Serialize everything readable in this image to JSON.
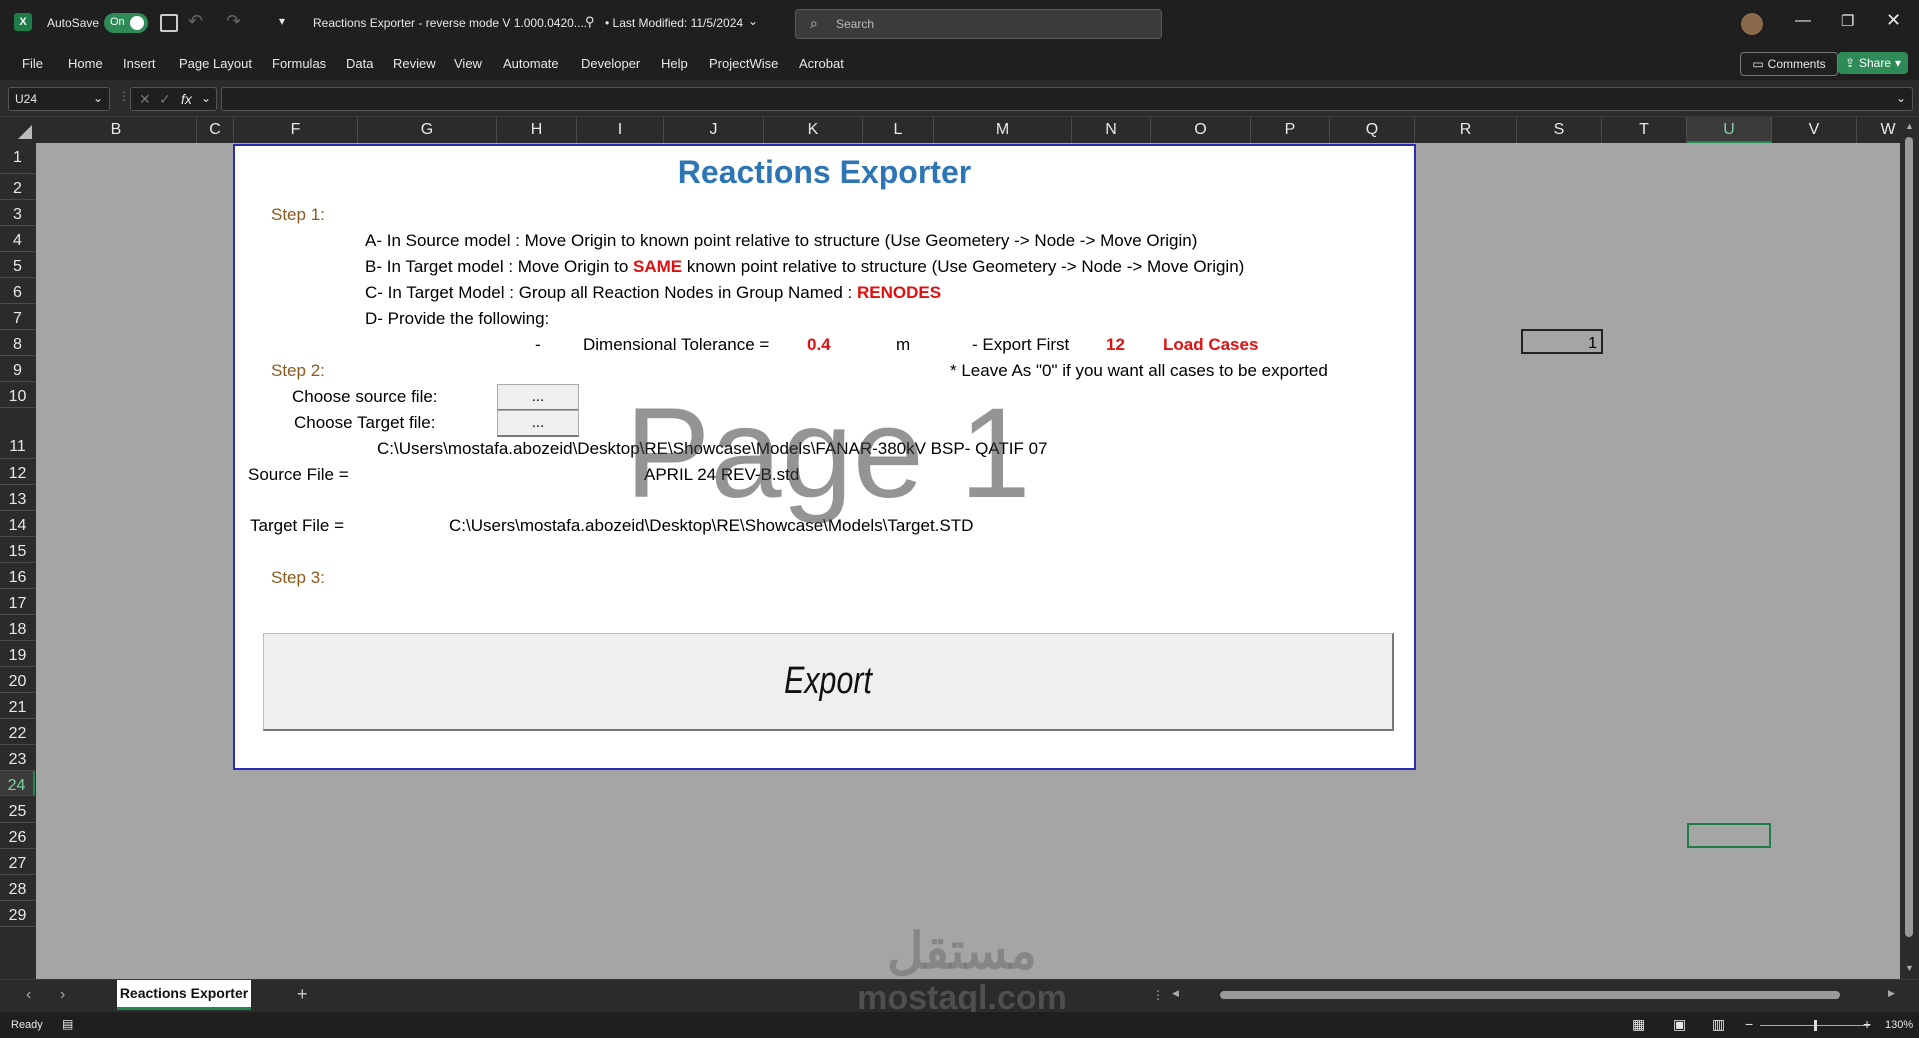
{
  "titlebar": {
    "autosave_label": "AutoSave",
    "autosave_state": "On",
    "doc_title": "Reactions Exporter - reverse mode V 1.000.0420....",
    "last_modified": "• Last Modified: 11/5/2024",
    "search_placeholder": "Search"
  },
  "ribbon": {
    "menu": [
      "File",
      "Home",
      "Insert",
      "Page Layout",
      "Formulas",
      "Data",
      "Review",
      "View",
      "Automate",
      "Developer",
      "Help",
      "ProjectWise",
      "Acrobat"
    ],
    "comments_label": "Comments",
    "share_label": "Share"
  },
  "formula_bar": {
    "name_box": "U24",
    "fx": "fx",
    "formula": ""
  },
  "columns": [
    "B",
    "C",
    "F",
    "G",
    "H",
    "I",
    "J",
    "K",
    "L",
    "M",
    "N",
    "O",
    "P",
    "Q",
    "R",
    "S",
    "T",
    "U",
    "V",
    "W"
  ],
  "rows": [
    "1",
    "2",
    "3",
    "4",
    "5",
    "6",
    "7",
    "8",
    "9",
    "10",
    "11",
    "12",
    "13",
    "14",
    "15",
    "16",
    "17",
    "18",
    "19",
    "20",
    "21",
    "22",
    "23",
    "24",
    "25",
    "26",
    "27",
    "28",
    "29"
  ],
  "selected_cell": "U24",
  "panel": {
    "title": "Reactions Exporter",
    "step1": "Step 1:",
    "line_a": "A- In Source model : Move Origin to known point relative to structure (Use Geometery -> Node -> Move Origin)",
    "line_b_pre": "B- In Target model : Move Origin to ",
    "line_b_red": "SAME",
    "line_b_post": " known point relative to structure (Use Geometery -> Node -> Move Origin)",
    "line_c_pre": "C- In Target Model : Group all Reaction Nodes in Group Named : ",
    "line_c_red": "RENODES",
    "line_d": "D- Provide the following:",
    "dash": "-",
    "tolerance_label": "Dimensional Tolerance =",
    "tolerance_value": "0.4",
    "tolerance_unit": "m",
    "export_first_label": "- Export First",
    "export_first_value": "12",
    "load_cases": "Load Cases",
    "step2": "Step 2:",
    "leave_note": "* Leave As \"0\" if you want all cases to be exported",
    "choose_source": "Choose source file:",
    "choose_target": "Choose Target file:",
    "browse": "...",
    "source_path_1": "C:\\Users\\mostafa.abozeid\\Desktop\\RE\\Showcase\\Models\\FANAR-380kV BSP- QATIF  07",
    "source_path_2": "APRIL 24 REV-B.std",
    "source_label": "Source File =",
    "target_label": "Target File =",
    "target_path": "C:\\Users\\mostafa.abozeid\\Desktop\\RE\\Showcase\\Models\\Target.STD",
    "step3": "Step 3:",
    "export_button": "Export"
  },
  "watermark": "Page 1",
  "cell_value_s7": "1",
  "sheet_tab": "Reactions Exporter",
  "status": {
    "ready": "Ready",
    "zoom": "130%"
  },
  "site_watermark": {
    "arabic": "مستقل",
    "latin": "mostaql.com"
  },
  "colors": {
    "title_blue": "#2e75b6",
    "red": "#e01010",
    "step_brown": "#8a5a1e",
    "excel_green": "#1e8a4c"
  }
}
